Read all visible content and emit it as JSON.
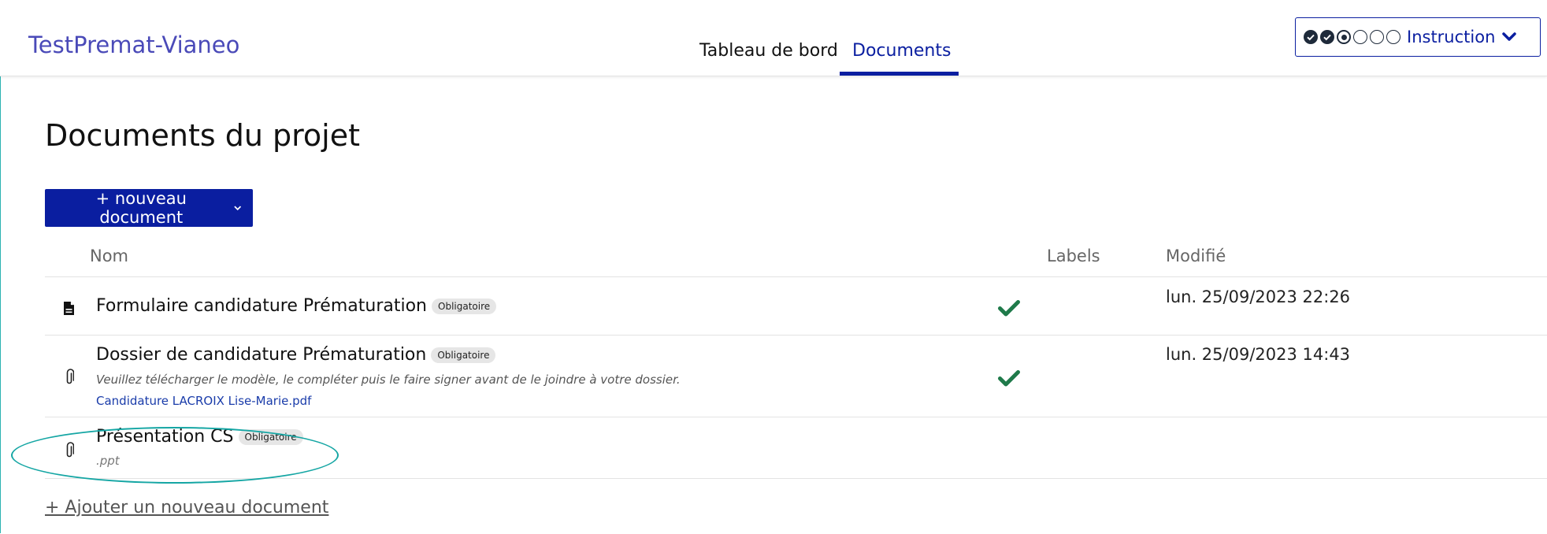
{
  "header": {
    "brand": "TestPremat-Vianeo",
    "nav": [
      {
        "label": "Tableau de bord",
        "active": false
      },
      {
        "label": "Documents",
        "active": true
      }
    ],
    "status": {
      "steps": [
        "done",
        "done",
        "current",
        "todo",
        "todo",
        "todo"
      ],
      "label": "Instruction"
    }
  },
  "page": {
    "title": "Documents du projet",
    "new_document_label": "+ nouveau document"
  },
  "table": {
    "columns": {
      "name": "Nom",
      "labels": "Labels",
      "modified": "Modifié"
    },
    "rows": [
      {
        "icon": "document-icon",
        "name": "Formulaire candidature Prématuration",
        "badge": "Obligatoire",
        "completed": true,
        "modified": "lun. 25/09/2023 22:26"
      },
      {
        "icon": "paperclip-icon",
        "name": "Dossier de candidature Prématuration",
        "badge": "Obligatoire",
        "description": "Veuillez télécharger le modèle, le compléter puis le faire signer avant de le joindre à votre dossier.",
        "file": "Candidature LACROIX Lise-Marie.pdf",
        "completed": true,
        "modified": "lun. 25/09/2023 14:43"
      },
      {
        "icon": "paperclip-icon",
        "name": "Présentation CS",
        "badge": "Obligatoire",
        "extension": ".ppt",
        "completed": false,
        "modified": ""
      }
    ]
  },
  "footer": {
    "add_document_label": "+ Ajouter un nouveau document"
  },
  "colors": {
    "primary": "#0a1ea0",
    "brand": "#4a4ab8",
    "check": "#1f7a4a",
    "annotation": "#15a6a4"
  }
}
